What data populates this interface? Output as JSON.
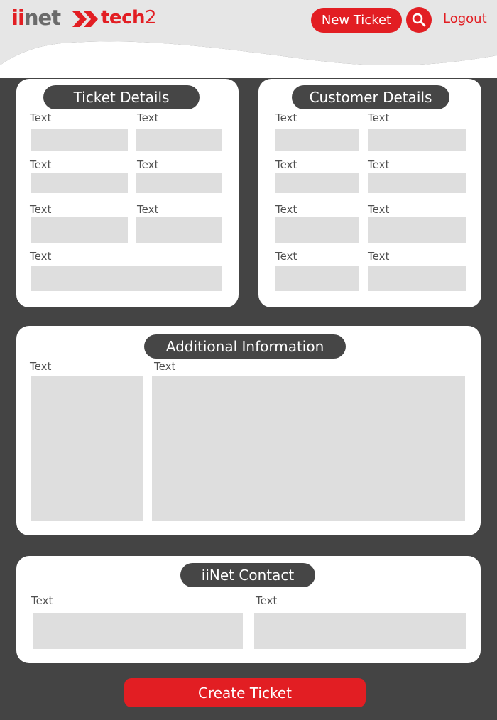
{
  "header": {
    "logo_iinet_ii": "ii",
    "logo_iinet_rest": "net",
    "logo_tech2_word": "tech",
    "logo_tech2_num": "2",
    "new_ticket_label": "New Ticket",
    "search_icon": "search-icon",
    "logout_label": "Logout"
  },
  "colors": {
    "brand_red": "#e21e23",
    "background": "#444444",
    "pill": "#464646",
    "field": "#dedede"
  },
  "ticket_details": {
    "title": "Ticket Details",
    "labels": [
      "Text",
      "Text",
      "Text",
      "Text",
      "Text",
      "Text",
      "Text"
    ]
  },
  "customer_details": {
    "title": "Customer Details",
    "labels": [
      "Text",
      "Text",
      "Text",
      "Text",
      "Text",
      "Text",
      "Text",
      "Text"
    ]
  },
  "additional_information": {
    "title": "Additional Information",
    "labels": [
      "Text",
      "Text"
    ]
  },
  "iinet_contact": {
    "title": "iiNet Contact",
    "labels": [
      "Text",
      "Text"
    ]
  },
  "create_ticket_label": "Create Ticket"
}
